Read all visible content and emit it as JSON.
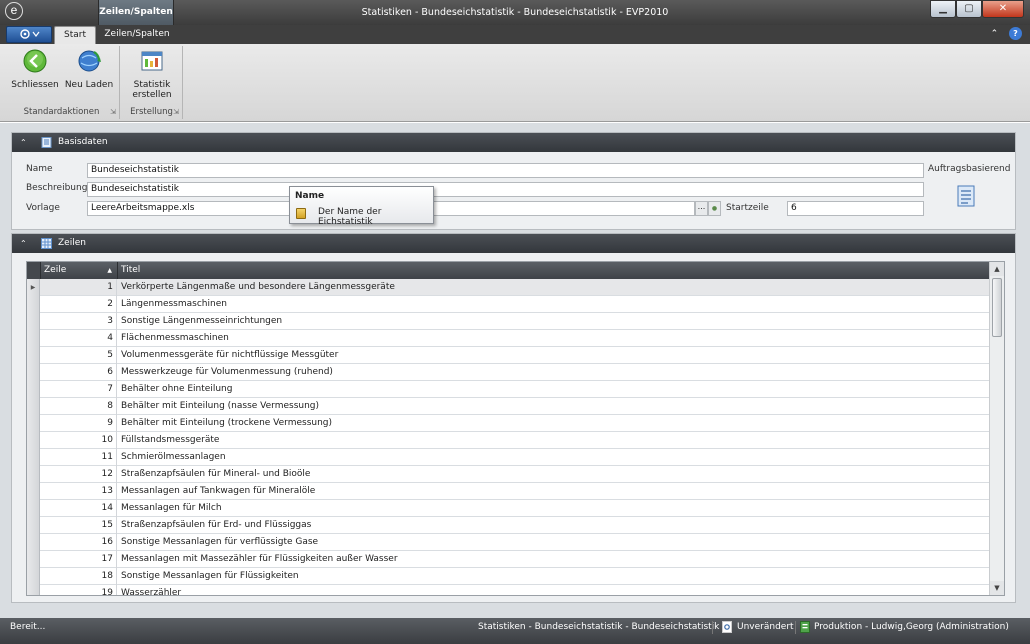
{
  "window": {
    "title": "Statistiken - Bundeseichstatistik - Bundeseichstatistik - EVP2010",
    "context_tab_header": "Zeilen/Spalten",
    "logo_glyph": "e",
    "minimize": "▁",
    "maximize": "▢",
    "close": "✕"
  },
  "ribbon": {
    "tabs": [
      {
        "label": "Start",
        "active": true
      },
      {
        "label": "Zeilen/Spalten",
        "active": false
      }
    ],
    "collapse_glyph": "⌃",
    "help_glyph": "?",
    "groups": [
      {
        "label": "Standardaktionen",
        "buttons": [
          "Schliessen",
          "Neu Laden"
        ]
      },
      {
        "label": "Erstellung",
        "buttons": [
          "Statistik erstellen"
        ]
      }
    ],
    "stat_btn_line1": "Statistik",
    "stat_btn_line2": "erstellen"
  },
  "basisdaten": {
    "title": "Basisdaten",
    "name_label": "Name",
    "name_value": "Bundeseichstatistik",
    "beschreibung_label": "Beschreibung",
    "beschreibung_value": "Bundeseichstatistik",
    "vorlage_label": "Vorlage",
    "vorlage_value": "LeereArbeitsmappe.xls",
    "startzeile_label": "Startzeile",
    "startzeile_value": "6",
    "auftragsbasierend_label": "Auftragsbasierend",
    "ellipsis": "...",
    "clear_glyph": "●"
  },
  "tooltip": {
    "title": "Name",
    "text": "Der Name der Eichstatistik"
  },
  "zeilen": {
    "title": "Zeilen",
    "columns": [
      "Zeile",
      "Titel"
    ],
    "sort_glyph": "▲",
    "rows": [
      {
        "zeile": "1",
        "titel": "Verkörperte Längenmaße und besondere Längenmessgeräte"
      },
      {
        "zeile": "2",
        "titel": "Längenmessmaschinen"
      },
      {
        "zeile": "3",
        "titel": "Sonstige Längenmesseinrichtungen"
      },
      {
        "zeile": "4",
        "titel": "Flächenmessmaschinen"
      },
      {
        "zeile": "5",
        "titel": "Volumenmessgeräte für nichtflüssige Messgüter"
      },
      {
        "zeile": "6",
        "titel": "Messwerkzeuge für Volumenmessung  (ruhend)"
      },
      {
        "zeile": "7",
        "titel": "Behälter ohne Einteilung"
      },
      {
        "zeile": "8",
        "titel": "Behälter mit Einteilung (nasse Vermessung)"
      },
      {
        "zeile": "9",
        "titel": "Behälter mit Einteilung (trockene Vermessung)"
      },
      {
        "zeile": "10",
        "titel": "Füllstandsmessgeräte"
      },
      {
        "zeile": "11",
        "titel": "Schmierölmessanlagen"
      },
      {
        "zeile": "12",
        "titel": "Straßenzapfsäulen für Mineral- und Bioöle"
      },
      {
        "zeile": "13",
        "titel": "Messanlagen auf Tankwagen für Mineralöle"
      },
      {
        "zeile": "14",
        "titel": "Messanlagen für Milch"
      },
      {
        "zeile": "15",
        "titel": "Straßenzapfsäulen für Erd- und Flüssiggas"
      },
      {
        "zeile": "16",
        "titel": "Sonstige Messanlagen für verflüssigte Gase"
      },
      {
        "zeile": "17",
        "titel": "Messanlagen mit Massezähler für Flüssigkeiten außer Wasser"
      },
      {
        "zeile": "18",
        "titel": "Sonstige Messanlagen für Flüssigkeiten"
      },
      {
        "zeile": "19",
        "titel": "Wasserzähler"
      }
    ],
    "scroll_up": "▲",
    "scroll_down": "▼",
    "row_indicator": "▶"
  },
  "statusbar": {
    "left": "Bereit...",
    "context": "Statistiken - Bundeseichstatistik - Bundeseichstatistik",
    "state": "Unverändert",
    "user": "Produktion - Ludwig,Georg (Administration)"
  },
  "colors": {
    "header_dark": "#3c3c3c",
    "accent_blue": "#1f4f94",
    "close_red": "#c2361c"
  }
}
